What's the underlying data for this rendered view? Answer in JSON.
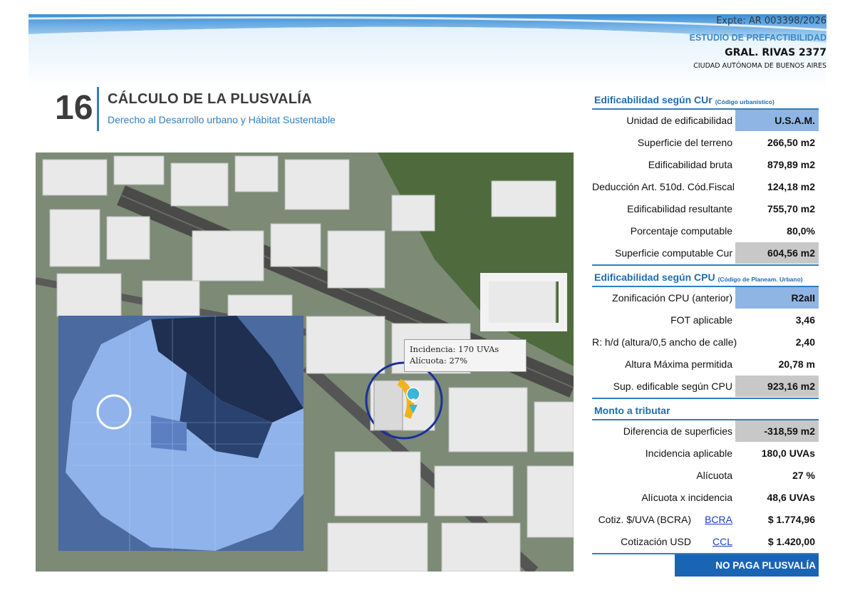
{
  "header": {
    "expediente": "Expte: AR 003398/2026",
    "estudio": "ESTUDIO DE PREFACTIBILIDAD",
    "address": "GRAL. RIVAS 2377",
    "city": "CIUDAD AUTÓNOMA DE BUENOS AIRES"
  },
  "section": {
    "number": "16",
    "title": "CÁLCULO DE LA PLUSVALÍA",
    "subtitle": "Derecho al Desarrollo urbano y Hábitat Sustentable"
  },
  "map": {
    "callout_line1": "Incidencia: 170 UVAs",
    "callout_line2": "Alícuota: 27%"
  },
  "table": {
    "cur": {
      "title": "Edificabilidad según CUr",
      "note": "(Código urbanístico)",
      "rows": [
        {
          "label": "Unidad de edificabilidad",
          "value": "U.S.A.M."
        },
        {
          "label": "Superficie del terreno",
          "value": "266,50 m2"
        },
        {
          "label": "Edificabilidad bruta",
          "value": "879,89 m2"
        },
        {
          "label": "Deducción Art. 510d. Cód.Fiscal",
          "value": "124,18 m2"
        },
        {
          "label": "Edificabilidad resultante",
          "value": "755,70 m2"
        },
        {
          "label": "Porcentaje computable",
          "value": "80,0%"
        },
        {
          "label": "Superficie computable Cur",
          "value": "604,56 m2"
        }
      ]
    },
    "cpu": {
      "title": "Edificabilidad según CPU",
      "note": "(Código de Planeam. Urbano)",
      "rows": [
        {
          "label": "Zonificación CPU (anterior)",
          "value": "R2aII"
        },
        {
          "label": "FOT aplicable",
          "value": "3,46"
        },
        {
          "label": "R: h/d (altura/0,5 ancho de calle)",
          "value": "2,40"
        },
        {
          "label": "Altura Máxima permitida",
          "value": "20,78 m"
        },
        {
          "label": "Sup. edificable según CPU",
          "value": "923,16 m2"
        }
      ]
    },
    "monto": {
      "title": "Monto a tributar",
      "rows": [
        {
          "label": "Diferencia de superficies",
          "value": "-318,59 m2"
        },
        {
          "label": "Incidencia aplicable",
          "value": "180,0 UVAs"
        },
        {
          "label": "Alícuota",
          "value": "27 %"
        },
        {
          "label": "Alícuota x incidencia",
          "value": "48,6 UVAs"
        }
      ],
      "cotiz_uva": {
        "label": "Cotiz. $/UVA (BCRA)",
        "link": "BCRA",
        "value": "$ 1.774,96"
      },
      "cotiz_usd": {
        "label": "Cotización USD",
        "link": "CCL",
        "value": "$ 1.420,00"
      }
    },
    "result": "NO PAGA PLUSVALÍA"
  },
  "colors": {
    "accent_blue": "#2e7fc2",
    "highlight_blue": "#8fb5e5",
    "highlight_gray": "#c8c8c8",
    "result_bg": "#1a64b4"
  }
}
